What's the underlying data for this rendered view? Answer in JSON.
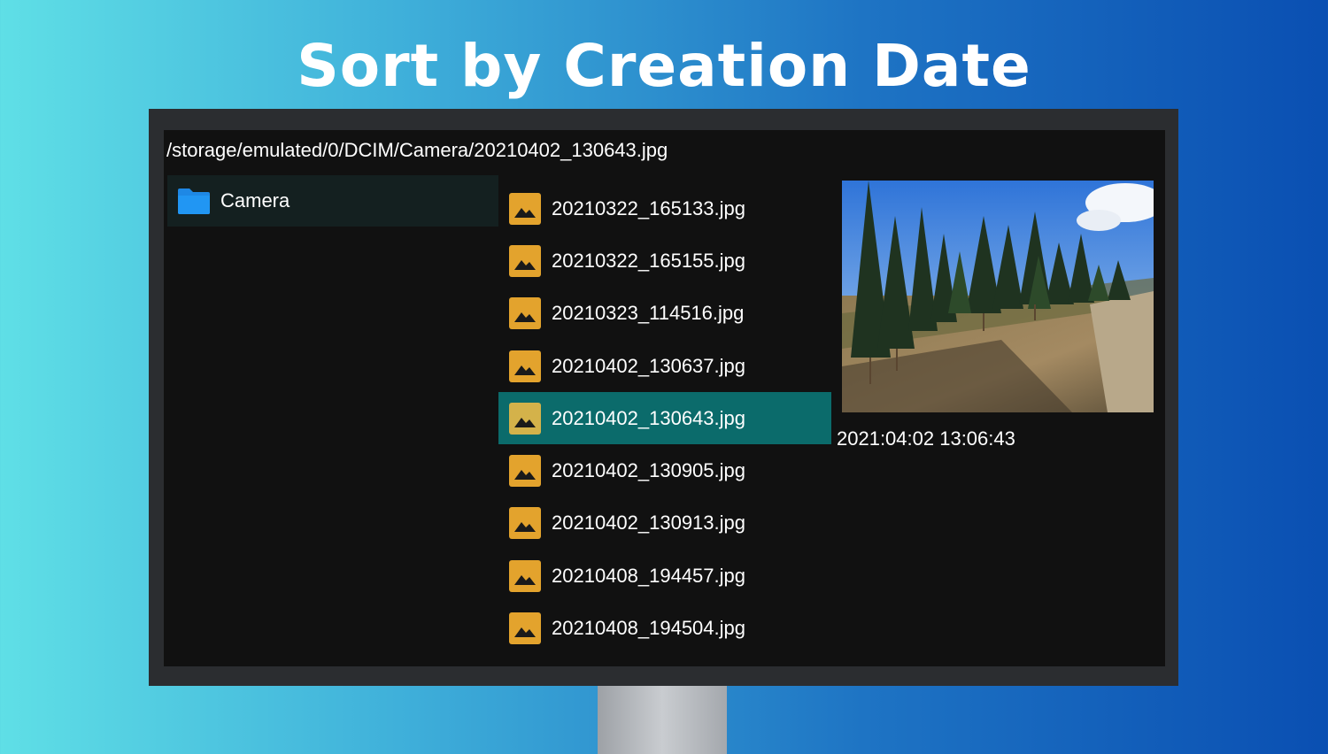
{
  "headline": "Sort by Creation Date",
  "path": "/storage/emulated/0/DCIM/Camera/20210402_130643.jpg",
  "folder": {
    "label": "Camera",
    "icon": "folder-icon",
    "color": "#1e88e5"
  },
  "files": [
    {
      "name": "20210322_165133.jpg",
      "icon": "image-icon",
      "selected": false
    },
    {
      "name": "20210322_165155.jpg",
      "icon": "image-icon",
      "selected": false
    },
    {
      "name": "20210323_114516.jpg",
      "icon": "image-icon",
      "selected": false
    },
    {
      "name": "20210402_130637.jpg",
      "icon": "image-icon",
      "selected": false
    },
    {
      "name": "20210402_130643.jpg",
      "icon": "image-icon",
      "selected": true
    },
    {
      "name": "20210402_130905.jpg",
      "icon": "image-icon",
      "selected": false
    },
    {
      "name": "20210402_130913.jpg",
      "icon": "image-icon",
      "selected": false
    },
    {
      "name": "20210408_194457.jpg",
      "icon": "image-icon",
      "selected": false
    },
    {
      "name": "20210408_194504.jpg",
      "icon": "image-icon",
      "selected": false
    }
  ],
  "preview": {
    "timestamp": "2021:04:02 13:06:43"
  },
  "colors": {
    "selection": "#0b6b6b",
    "image_icon": "#e3a32d",
    "screen_bg": "#111111"
  }
}
